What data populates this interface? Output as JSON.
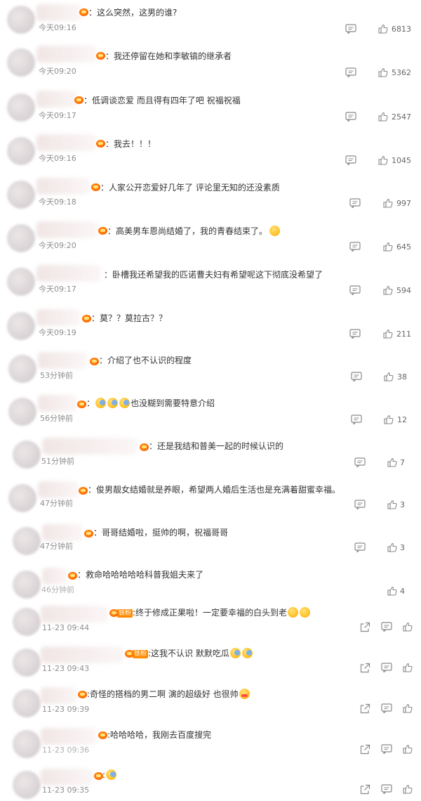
{
  "comments": [
    {
      "text": "：这么突然，这男的谁?",
      "time": "今天09:16",
      "likes": "6813"
    },
    {
      "text": "：我还停留在她和李敏镐的继承者",
      "time": "今天09:20",
      "likes": "5362"
    },
    {
      "text": "：低调谈恋爱 而且得有四年了吧 祝福祝福",
      "time": "今天09:17",
      "likes": "2547"
    },
    {
      "text": "：我去！！！",
      "time": "今天09:16",
      "likes": "1045"
    },
    {
      "text": "：人家公开恋爱好几年了 评论里无知的还没素质",
      "time": "今天09:18",
      "likes": "997"
    },
    {
      "text": "：高美男车恩尚结婚了，我的青春结束了。",
      "time": "今天09:20",
      "likes": "645"
    },
    {
      "text": "：卧槽我还希望我的匹诺曹夫妇有希望呢这下彻底没希望了",
      "time": "今天09:17",
      "likes": "594"
    },
    {
      "text": "：莫？？莫拉古？？",
      "time": "今天09:19",
      "likes": "211"
    },
    {
      "text": "：介绍了也不认识的程度",
      "time": "53分钟前",
      "likes": "38"
    },
    {
      "text": "也没糊到需要特意介绍",
      "time": "56分钟前",
      "likes": "12"
    },
    {
      "text": "：还是我结和普美一起的时候认识的",
      "time": "51分钟前",
      "likes": "7"
    },
    {
      "text": "：俊男靓女结婚就是养眼，希望两人婚后生活也是充满着甜蜜幸福。",
      "time": "47分钟前",
      "likes": "3"
    },
    {
      "text": "：哥哥结婚啦，挺帅的啊，祝福哥哥",
      "time": "47分钟前",
      "likes": "3"
    },
    {
      "text": "：救命哈哈哈哈哈科普我姐夫来了",
      "time": "46分钟前",
      "likes": "4"
    },
    {
      "text": ":终于修成正果啦！一定要幸福的白头到老",
      "time": "11-23 09:44",
      "tag": "铁粉"
    },
    {
      "text": ":这我不认识 默默吃瓜",
      "time": "11-23 09:43",
      "tag": "铁粉"
    },
    {
      "text": ":奇怪的搭档的男二啊 演的超级好 也很帅",
      "time": "11-23 09:39"
    },
    {
      "text": ":哈哈哈哈，我刚去百度搜完",
      "time": "11-23 09:36"
    },
    {
      "text": ":",
      "time": "11-23 09:35"
    }
  ],
  "icons": {
    "comment": "comment-icon",
    "like": "thumbs-up-icon",
    "share": "share-icon",
    "emoji": "emoji-icon"
  },
  "colors": {
    "text": "#333333",
    "meta": "#8f8f8f",
    "icon": "#8a8a8a",
    "badge": "#ff6a00"
  }
}
